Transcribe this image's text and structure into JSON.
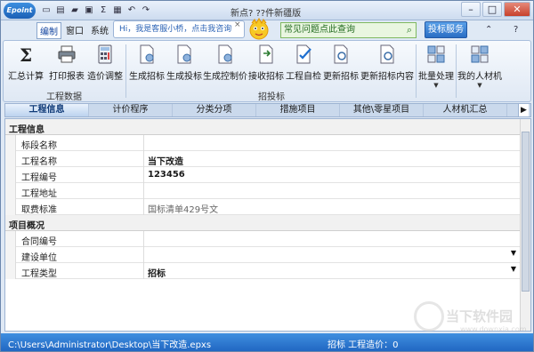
{
  "app": {
    "logo_text": "Epoint",
    "title": "新点? ??件新疆版"
  },
  "qat": [
    "new-icon",
    "open-icon",
    "folder-icon",
    "save-icon",
    "sigma-icon",
    "grid-icon",
    "undo-icon",
    "redo-icon"
  ],
  "menu": {
    "tabs": [
      "编制",
      "窗口",
      "系统",
      "帮"
    ],
    "active": "编制",
    "chat_text": "Hi，我是客服小桥，点击我咨询",
    "chat_close": "×",
    "faq_text": "常见问题点此查询",
    "service_button": "投标服务"
  },
  "ribbon": {
    "groups": {
      "project_data": "工程数据",
      "bidding": "招投标"
    },
    "buttons": {
      "summarize": "汇总计算",
      "print": "打印报表",
      "adjust_price": "造价调整",
      "gen_bid_invite": "生成招标",
      "gen_bid_submit": "生成投标",
      "gen_control_price": "生成控制价",
      "receive_bid": "接收招标",
      "self_check": "工程自检",
      "update_bid": "更新招标",
      "update_bid_content": "更新招标内容",
      "batch_process": "批量处理",
      "my_materials": "我的人材机"
    }
  },
  "sheet_tabs": [
    "工程信息",
    "计价程序",
    "分类分项",
    "措施项目",
    "其他\\零星项目",
    "人材机汇总"
  ],
  "grid": {
    "section1": "工程信息",
    "section2": "项目概况",
    "rows1": [
      {
        "label": "标段名称",
        "value": ""
      },
      {
        "label": "工程名称",
        "value": "当下改造"
      },
      {
        "label": "工程编号",
        "value": "123456"
      },
      {
        "label": "工程地址",
        "value": ""
      },
      {
        "label": "取费标准",
        "value": "国标清单429号文"
      }
    ],
    "rows2": [
      {
        "label": "合同编号",
        "value": ""
      },
      {
        "label": "建设单位",
        "value": ""
      },
      {
        "label": "工程类型",
        "value": "招标"
      }
    ]
  },
  "status": {
    "path": "C:\\Users\\Administrator\\Desktop\\当下改造.epxs",
    "right": "招标 工程造价：0"
  },
  "watermark": {
    "text": "当下软件园",
    "url": "www.downxia.com"
  }
}
